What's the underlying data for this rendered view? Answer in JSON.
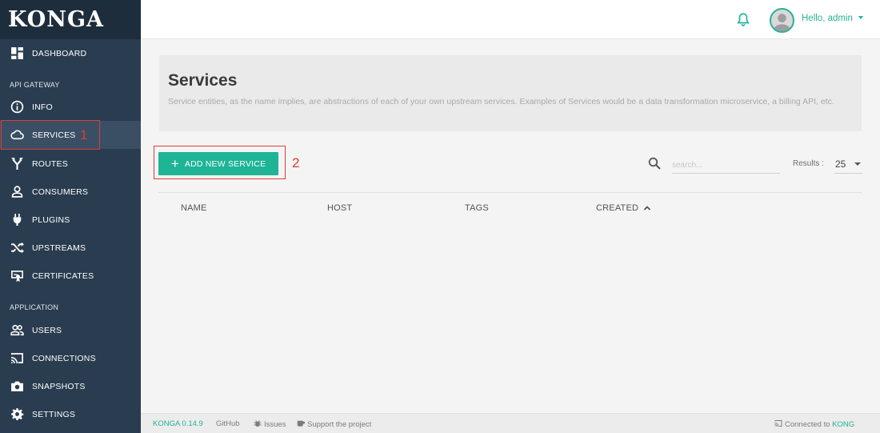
{
  "app": {
    "logo": "KONGA"
  },
  "sidebar": {
    "dashboard": {
      "label": "DASHBOARD",
      "icon": "dashboard-icon"
    },
    "section_api": "API GATEWAY",
    "api_items": [
      {
        "label": "INFO",
        "icon": "info-icon"
      },
      {
        "label": "SERVICES",
        "icon": "cloud-icon"
      },
      {
        "label": "ROUTES",
        "icon": "routes-icon"
      },
      {
        "label": "CONSUMERS",
        "icon": "person-icon"
      },
      {
        "label": "PLUGINS",
        "icon": "plug-icon"
      },
      {
        "label": "UPSTREAMS",
        "icon": "shuffle-icon"
      },
      {
        "label": "CERTIFICATES",
        "icon": "certificate-icon"
      }
    ],
    "section_app": "APPLICATION",
    "app_items": [
      {
        "label": "USERS",
        "icon": "users-icon"
      },
      {
        "label": "CONNECTIONS",
        "icon": "cast-icon"
      },
      {
        "label": "SNAPSHOTS",
        "icon": "camera-icon"
      },
      {
        "label": "SETTINGS",
        "icon": "gear-icon"
      }
    ],
    "active_item": "SERVICES"
  },
  "topbar": {
    "greeting": "Hello, admin"
  },
  "page": {
    "title": "Services",
    "description": "Service entities, as the name implies, are abstractions of each of your own upstream services. Examples of Services would be a data transformation microservice, a billing API, etc."
  },
  "toolbar": {
    "add_label": "ADD NEW SERVICE",
    "search_placeholder": "search...",
    "results_label": "Results :",
    "results_value": "25"
  },
  "table": {
    "columns": [
      "NAME",
      "HOST",
      "TAGS",
      "CREATED"
    ],
    "sort_column": "CREATED",
    "sort_direction": "asc",
    "rows": []
  },
  "annotations": {
    "marker1": "1",
    "marker2": "2"
  },
  "footer": {
    "version": "KONGA 0.14.9",
    "github": "GitHub",
    "issues": "Issues",
    "support": "Support the project",
    "connected_prefix": "Connected to",
    "connected_target": "KONG"
  },
  "colors": {
    "accent": "#1fb496",
    "sidebar": "#2a3c4f",
    "annotation": "#e03b3b"
  }
}
